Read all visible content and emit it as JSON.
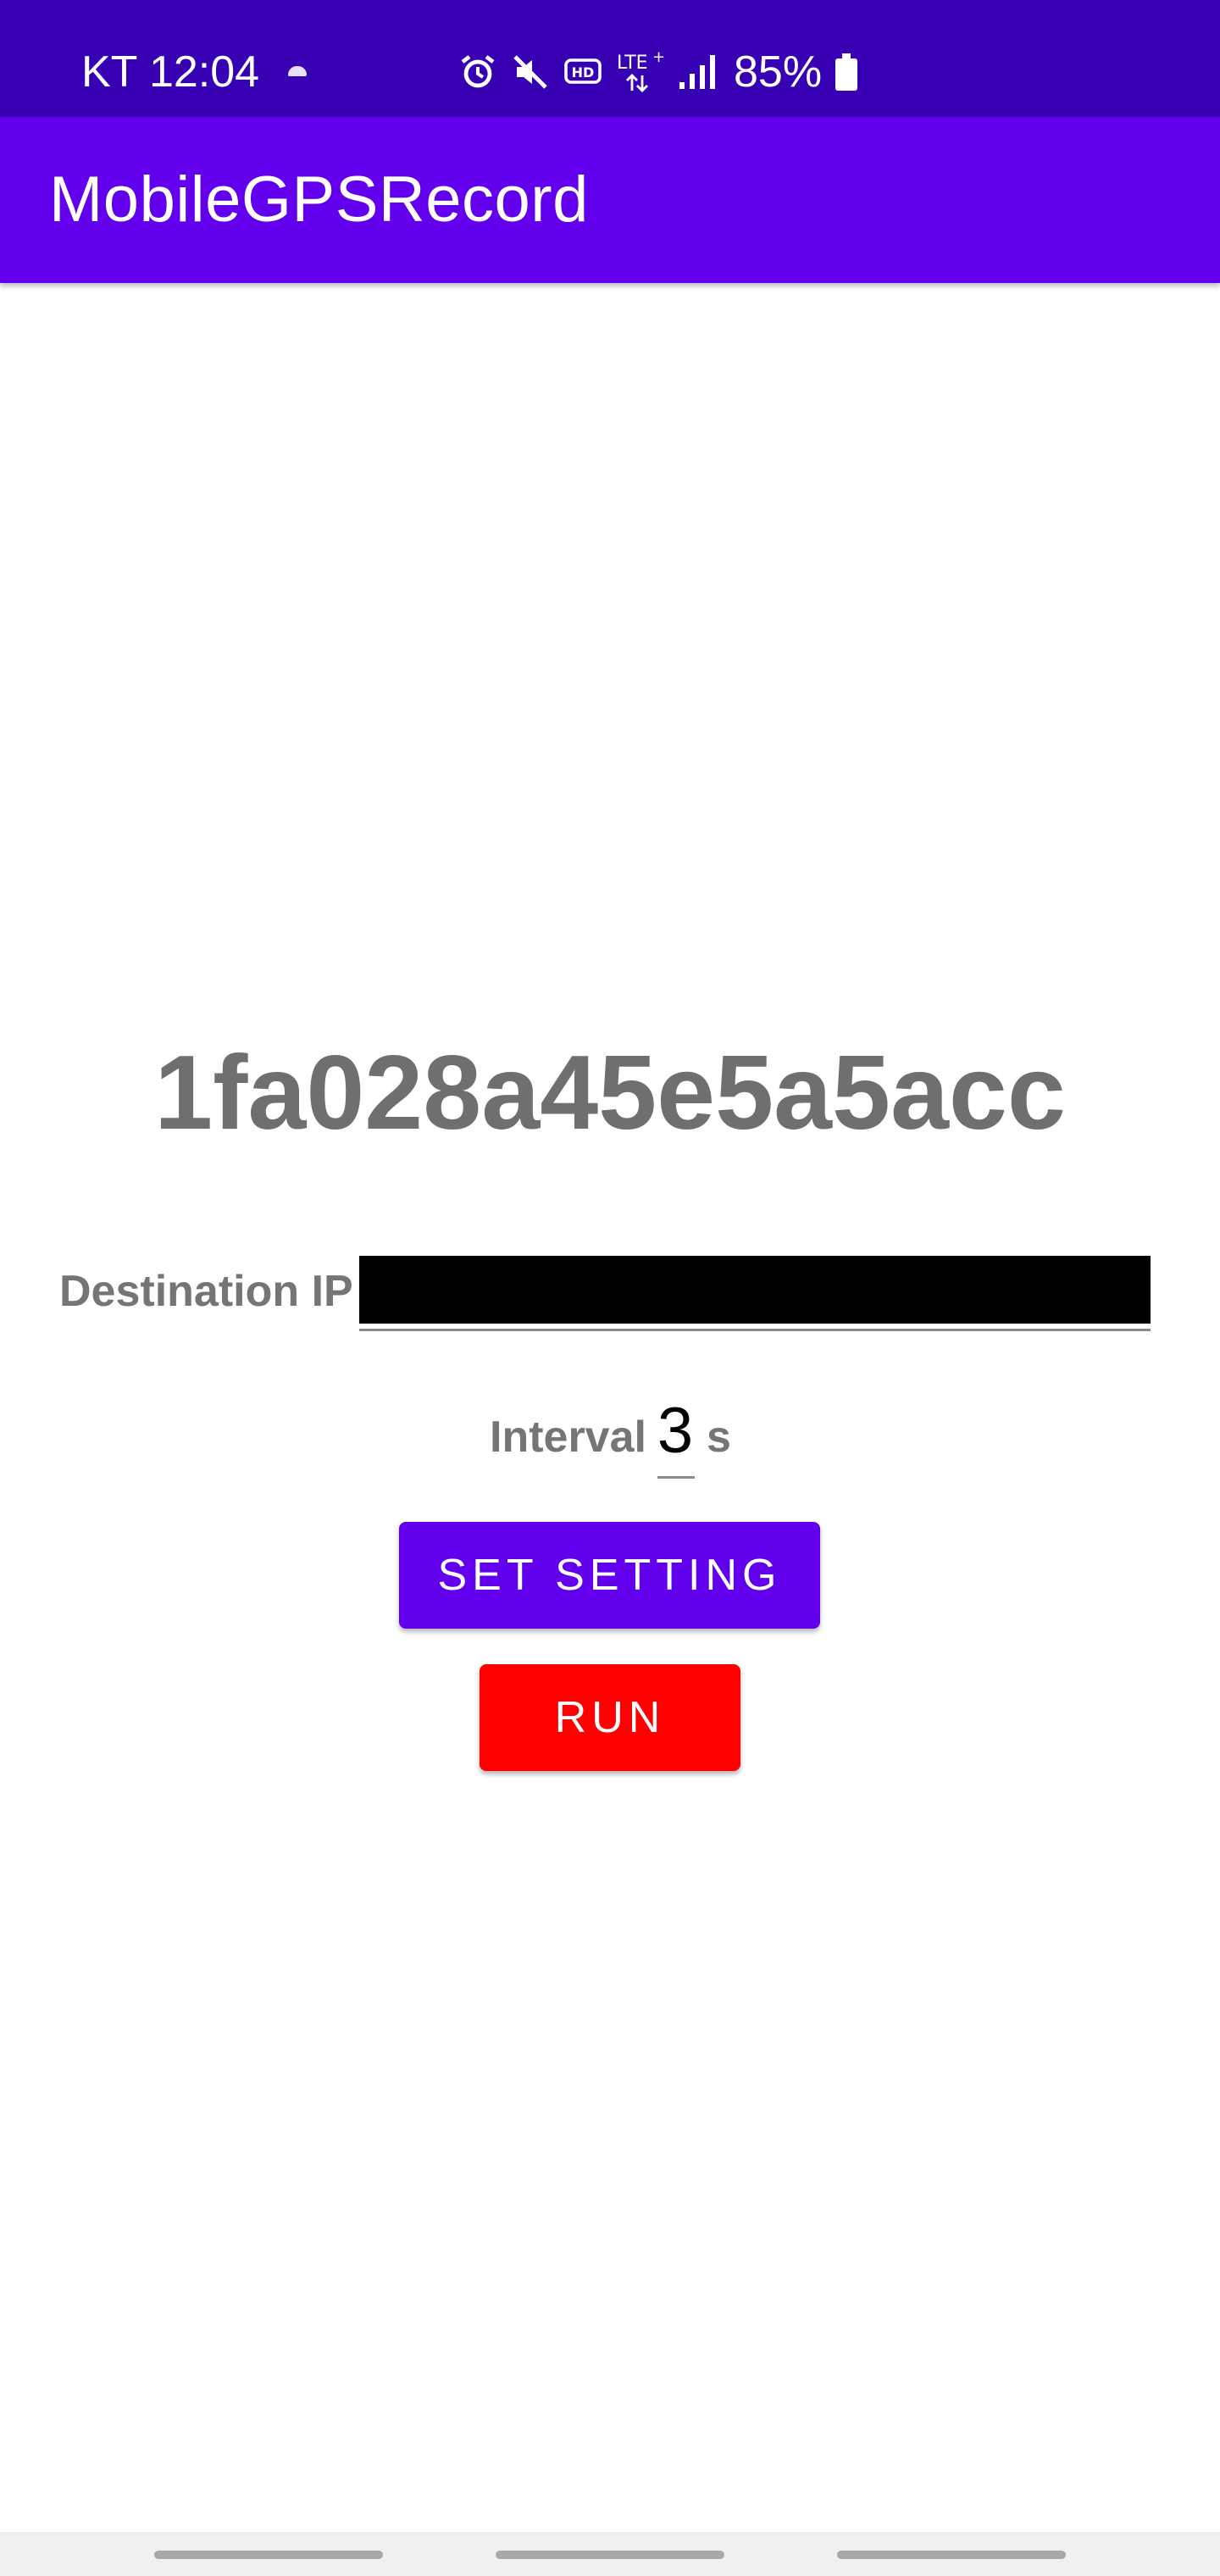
{
  "status_bar": {
    "carrier_time": "KT 12:04",
    "battery": "85%",
    "icons": [
      "alarm-icon",
      "mute-icon",
      "hd-voice-icon",
      "lte-plus-icon",
      "signal-icon",
      "battery-icon"
    ]
  },
  "app_bar": {
    "title": "MobileGPSRecord"
  },
  "main": {
    "device_id": "1fa028a45e5a5acc",
    "destination_label": "Destination IP",
    "destination_value": "",
    "interval_label": "Interval",
    "interval_value": "3",
    "interval_unit": "s",
    "set_setting_label": "SET SETTING",
    "run_label": "RUN"
  },
  "colors": {
    "status_bar": "#3700b3",
    "app_bar": "#6200ee",
    "primary_button": "#6200ee",
    "run_button": "#ff0000",
    "label_gray": "#757575"
  }
}
